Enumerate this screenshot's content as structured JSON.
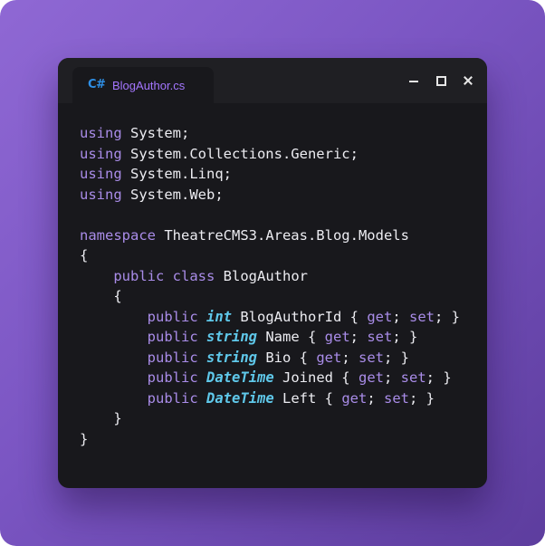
{
  "tab": {
    "icon": "C#",
    "filename": "BlogAuthor.cs"
  },
  "window_controls": [
    "minimize-icon",
    "maximize-icon",
    "close-icon"
  ],
  "colors": {
    "keyword": "#a98ce8",
    "type": "#5fc8ea",
    "plain": "#ececf1",
    "tab_label": "#a476ff",
    "csharp_icon": "#2e8fe6"
  },
  "code_lines": [
    {
      "indent": "",
      "tokens": [
        {
          "t": "using",
          "c": "kw"
        },
        {
          "t": " System;",
          "c": "pl"
        }
      ]
    },
    {
      "indent": "",
      "tokens": [
        {
          "t": "using",
          "c": "kw"
        },
        {
          "t": " System.Collections.Generic;",
          "c": "pl"
        }
      ]
    },
    {
      "indent": "",
      "tokens": [
        {
          "t": "using",
          "c": "kw"
        },
        {
          "t": " System.Linq;",
          "c": "pl"
        }
      ]
    },
    {
      "indent": "",
      "tokens": [
        {
          "t": "using",
          "c": "kw"
        },
        {
          "t": " System.Web;",
          "c": "pl"
        }
      ]
    },
    {
      "indent": "",
      "tokens": []
    },
    {
      "indent": "",
      "tokens": [
        {
          "t": "namespace",
          "c": "kw"
        },
        {
          "t": " TheatreCMS3.Areas.Blog.Models",
          "c": "pl"
        }
      ]
    },
    {
      "indent": "",
      "tokens": [
        {
          "t": "{",
          "c": "pl"
        }
      ]
    },
    {
      "indent": "    ",
      "tokens": [
        {
          "t": "public",
          "c": "kw"
        },
        {
          "t": " ",
          "c": "pl"
        },
        {
          "t": "class",
          "c": "kw"
        },
        {
          "t": " BlogAuthor",
          "c": "pl"
        }
      ]
    },
    {
      "indent": "    ",
      "tokens": [
        {
          "t": "{",
          "c": "pl"
        }
      ]
    },
    {
      "indent": "        ",
      "tokens": [
        {
          "t": "public",
          "c": "kw"
        },
        {
          "t": " ",
          "c": "pl"
        },
        {
          "t": "int",
          "c": "ty"
        },
        {
          "t": " BlogAuthorId { ",
          "c": "pl"
        },
        {
          "t": "get",
          "c": "kw"
        },
        {
          "t": "; ",
          "c": "pl"
        },
        {
          "t": "set",
          "c": "kw"
        },
        {
          "t": "; }",
          "c": "pl"
        }
      ]
    },
    {
      "indent": "        ",
      "tokens": [
        {
          "t": "public",
          "c": "kw"
        },
        {
          "t": " ",
          "c": "pl"
        },
        {
          "t": "string",
          "c": "ty"
        },
        {
          "t": " Name { ",
          "c": "pl"
        },
        {
          "t": "get",
          "c": "kw"
        },
        {
          "t": "; ",
          "c": "pl"
        },
        {
          "t": "set",
          "c": "kw"
        },
        {
          "t": "; }",
          "c": "pl"
        }
      ]
    },
    {
      "indent": "        ",
      "tokens": [
        {
          "t": "public",
          "c": "kw"
        },
        {
          "t": " ",
          "c": "pl"
        },
        {
          "t": "string",
          "c": "ty"
        },
        {
          "t": " Bio { ",
          "c": "pl"
        },
        {
          "t": "get",
          "c": "kw"
        },
        {
          "t": "; ",
          "c": "pl"
        },
        {
          "t": "set",
          "c": "kw"
        },
        {
          "t": "; }",
          "c": "pl"
        }
      ]
    },
    {
      "indent": "        ",
      "tokens": [
        {
          "t": "public",
          "c": "kw"
        },
        {
          "t": " ",
          "c": "pl"
        },
        {
          "t": "DateTime",
          "c": "ty"
        },
        {
          "t": " Joined { ",
          "c": "pl"
        },
        {
          "t": "get",
          "c": "kw"
        },
        {
          "t": "; ",
          "c": "pl"
        },
        {
          "t": "set",
          "c": "kw"
        },
        {
          "t": "; }",
          "c": "pl"
        }
      ]
    },
    {
      "indent": "        ",
      "tokens": [
        {
          "t": "public",
          "c": "kw"
        },
        {
          "t": " ",
          "c": "pl"
        },
        {
          "t": "DateTime",
          "c": "ty"
        },
        {
          "t": " Left { ",
          "c": "pl"
        },
        {
          "t": "get",
          "c": "kw"
        },
        {
          "t": "; ",
          "c": "pl"
        },
        {
          "t": "set",
          "c": "kw"
        },
        {
          "t": "; }",
          "c": "pl"
        }
      ]
    },
    {
      "indent": "    ",
      "tokens": [
        {
          "t": "}",
          "c": "pl"
        }
      ]
    },
    {
      "indent": "",
      "tokens": [
        {
          "t": "}",
          "c": "pl"
        }
      ]
    }
  ]
}
